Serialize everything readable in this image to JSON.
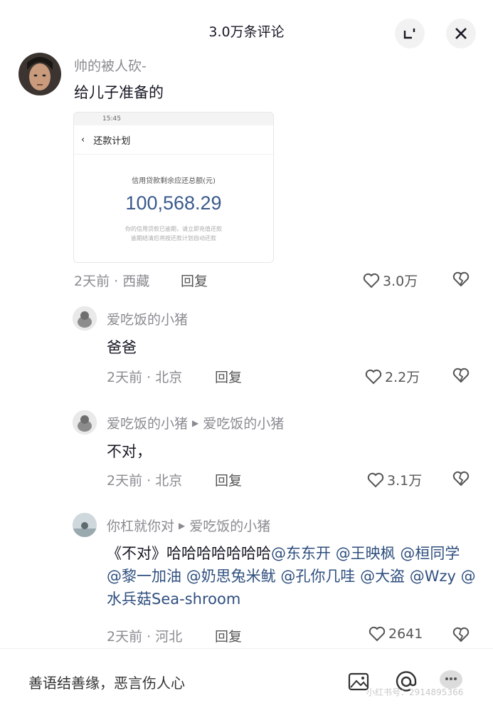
{
  "header": {
    "title": "3.0万条评论"
  },
  "comments": [
    {
      "author": "帅的被人砍-",
      "text": "给儿子准备的",
      "meta": "2天前 · 西藏",
      "reply": "回复",
      "likes": "3.0万",
      "attachment": {
        "status_time": "15:45",
        "nav_title": "还款计划",
        "label": "信用贷款剩余应还总额(元)",
        "amount": "100,568.29",
        "note_line1": "你的信用贷款已逾期，请立即充值还款",
        "note_line2": "逾期结清后将按还款计划自动还款"
      }
    },
    {
      "author": "爱吃饭的小猪",
      "text": "爸爸",
      "meta": "2天前 · 北京",
      "reply": "回复",
      "likes": "2.2万"
    },
    {
      "author": "爱吃饭的小猪",
      "reply_to": "爱吃饭的小猪",
      "text": "不对，",
      "meta": "2天前 · 北京",
      "reply": "回复",
      "likes": "3.1万"
    },
    {
      "author": "你杠就你对",
      "reply_to": "爱吃饭的小猪",
      "text_plain": "《不对》哈哈哈哈哈哈哈",
      "mentions": [
        "@东东开",
        "@王映枫",
        "@桓同学",
        "@黎一加油",
        "@奶思兔米鱿",
        "@孔你几哇",
        "@大盗",
        "@Wzy",
        "@水兵菇Sea-shroom"
      ],
      "meta": "2天前 · 河北",
      "reply": "回复",
      "likes": "2641"
    }
  ],
  "bottom": {
    "placeholder": "善语结善缘，恶言伤人心",
    "watermark": "小红书号：2914895366"
  },
  "colors": {
    "mention": "#2f4f7f",
    "meta": "#8a8b91",
    "amount": "#3a5a8c"
  },
  "icons": [
    "collapse-icon",
    "close-icon",
    "heart-icon",
    "dislike-heart-icon",
    "image-icon",
    "at-icon",
    "emoji-icon"
  ]
}
